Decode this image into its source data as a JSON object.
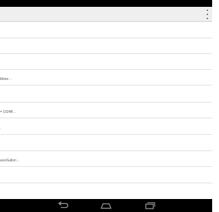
{
  "items": [
    {
      "label": ""
    },
    {
      "label": ""
    },
    {
      "label": ""
    },
    {
      "label": "Meter .."
    },
    {
      "label": ""
    },
    {
      "label": "= 1024B .."
    },
    {
      "label": "."
    },
    {
      "label": ""
    },
    {
      "label": "ace/Gallon .."
    },
    {
      "label": ""
    },
    {
      "label": ""
    }
  ],
  "icons": {
    "overflow": "overflow-menu-icon",
    "back": "back-icon",
    "home": "home-icon",
    "recents": "recents-icon"
  },
  "colors": {
    "status_bar": "#000000",
    "action_bar": "#efefef",
    "list_bg": "#ffffff",
    "divider": "#e0e0e0",
    "nav_bar": "#000000",
    "nav_icon": "#9e9e9e"
  }
}
